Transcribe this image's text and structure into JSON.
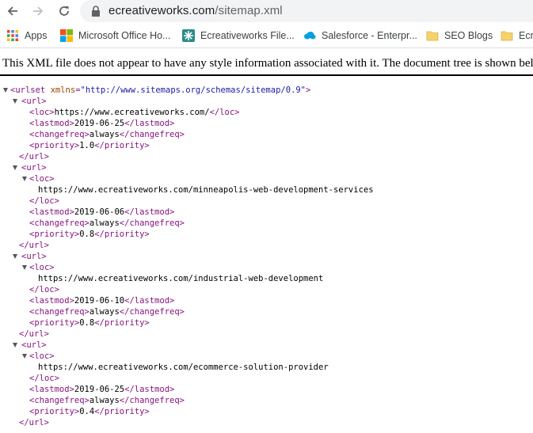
{
  "browser": {
    "url_host": "ecreativeworks.com",
    "url_path": "/sitemap.xml",
    "icons": {
      "back": "back-arrow-icon",
      "forward": "forward-arrow-icon",
      "reload": "reload-icon",
      "lock": "lock-icon"
    }
  },
  "bookmarks": [
    {
      "label": "Apps",
      "icon": "apps-grid-icon"
    },
    {
      "label": "Microsoft Office Ho...",
      "icon": "microsoft-logo-icon"
    },
    {
      "label": "Ecreativeworks File...",
      "icon": "ecreativeworks-icon"
    },
    {
      "label": "Salesforce - Enterpr...",
      "icon": "salesforce-cloud-icon"
    },
    {
      "label": "SEO Blogs",
      "icon": "folder-icon"
    },
    {
      "label": "Ecr",
      "icon": "folder-icon"
    }
  ],
  "notice": "This XML file does not appear to have any style information associated with it. The document tree is shown below.",
  "xml": {
    "root_tag": "urlset",
    "root_attr_name": "xmlns",
    "root_attr_value": "\"http://www.sitemaps.org/schemas/sitemap/0.9\"",
    "urls": [
      {
        "loc": "https://www.ecreativeworks.com/",
        "lastmod": "2019-06-25",
        "changefreq": "always",
        "priority": "1.0"
      },
      {
        "loc": "https://www.ecreativeworks.com/minneapolis-web-development-services",
        "lastmod": "2019-06-06",
        "changefreq": "always",
        "priority": "0.8"
      },
      {
        "loc": "https://www.ecreativeworks.com/industrial-web-development",
        "lastmod": "2019-06-10",
        "changefreq": "always",
        "priority": "0.8"
      },
      {
        "loc": "https://www.ecreativeworks.com/ecommerce-solution-provider",
        "lastmod": "2019-06-25",
        "changefreq": "always",
        "priority": "0.4"
      }
    ]
  },
  "colors": {
    "tag": "#881280",
    "attr_name": "#994500",
    "attr_value": "#1a1aa6",
    "text": "#000000"
  }
}
